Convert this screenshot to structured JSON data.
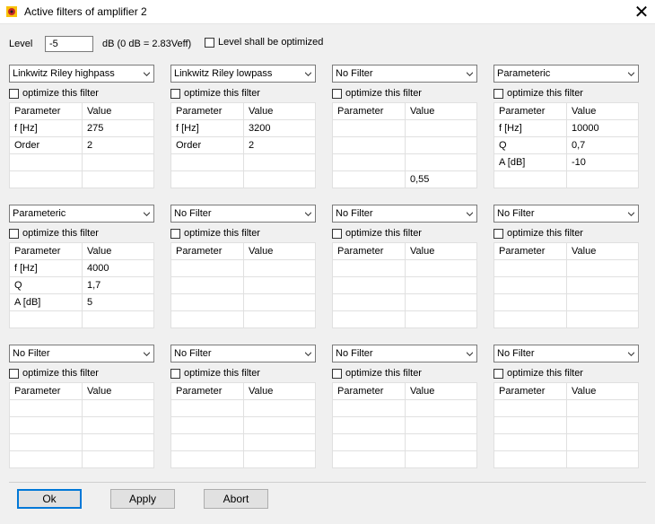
{
  "window": {
    "title": "Active filters of amplifier 2",
    "close_glyph": "✕"
  },
  "level": {
    "label": "Level",
    "value": "-5",
    "unit": "dB (0 dB = 2.83Veff)",
    "optimize_label": "Level shall be optimized"
  },
  "optimize_label": "optimize this filter",
  "columns": {
    "param": "Parameter",
    "value": "Value"
  },
  "filters": [
    {
      "type": "Linkwitz Riley highpass",
      "rows": [
        [
          "f [Hz]",
          "275"
        ],
        [
          "Order",
          "2"
        ],
        [
          "",
          ""
        ],
        [
          "",
          ""
        ]
      ]
    },
    {
      "type": "Linkwitz Riley lowpass",
      "rows": [
        [
          "f [Hz]",
          "3200"
        ],
        [
          "Order",
          "2"
        ],
        [
          "",
          ""
        ],
        [
          "",
          ""
        ]
      ]
    },
    {
      "type": "No Filter",
      "rows": [
        [
          "",
          ""
        ],
        [
          "",
          ""
        ],
        [
          "",
          ""
        ],
        [
          "",
          "0,55"
        ]
      ]
    },
    {
      "type": "Parameteric",
      "rows": [
        [
          "f [Hz]",
          "10000"
        ],
        [
          "Q",
          "0,7"
        ],
        [
          "A [dB]",
          "-10"
        ],
        [
          "",
          ""
        ]
      ]
    },
    {
      "type": "Parameteric",
      "rows": [
        [
          "f [Hz]",
          "4000"
        ],
        [
          "Q",
          "1,7"
        ],
        [
          "A [dB]",
          "5"
        ],
        [
          "",
          ""
        ]
      ]
    },
    {
      "type": "No Filter",
      "rows": [
        [
          "",
          ""
        ],
        [
          "",
          ""
        ],
        [
          "",
          ""
        ],
        [
          "",
          ""
        ]
      ]
    },
    {
      "type": "No Filter",
      "rows": [
        [
          "",
          ""
        ],
        [
          "",
          ""
        ],
        [
          "",
          ""
        ],
        [
          "",
          ""
        ]
      ]
    },
    {
      "type": "No Filter",
      "rows": [
        [
          "",
          ""
        ],
        [
          "",
          ""
        ],
        [
          "",
          ""
        ],
        [
          "",
          ""
        ]
      ]
    },
    {
      "type": "No Filter",
      "rows": [
        [
          "",
          ""
        ],
        [
          "",
          ""
        ],
        [
          "",
          ""
        ],
        [
          "",
          ""
        ]
      ]
    },
    {
      "type": "No Filter",
      "rows": [
        [
          "",
          ""
        ],
        [
          "",
          ""
        ],
        [
          "",
          ""
        ],
        [
          "",
          ""
        ]
      ]
    },
    {
      "type": "No Filter",
      "rows": [
        [
          "",
          ""
        ],
        [
          "",
          ""
        ],
        [
          "",
          ""
        ],
        [
          "",
          ""
        ]
      ]
    },
    {
      "type": "No Filter",
      "rows": [
        [
          "",
          ""
        ],
        [
          "",
          ""
        ],
        [
          "",
          ""
        ],
        [
          "",
          ""
        ]
      ]
    }
  ],
  "buttons": {
    "ok": "Ok",
    "apply": "Apply",
    "abort": "Abort"
  },
  "colors": {
    "focus_border": "#0078d7",
    "icon_red": "#c62828",
    "icon_yellow": "#f9c20a"
  }
}
